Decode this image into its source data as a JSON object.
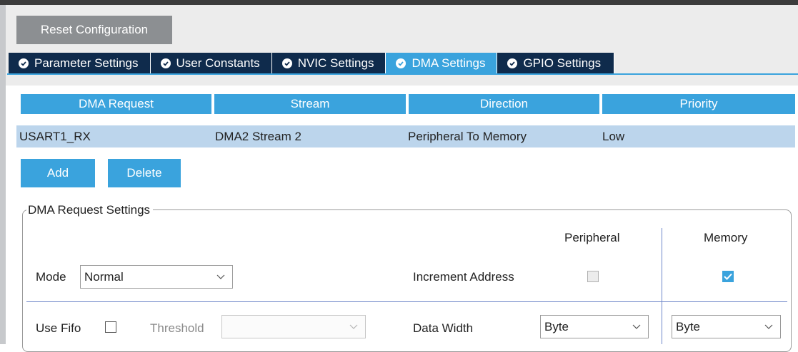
{
  "toolbar": {
    "reset_label": "Reset Configuration"
  },
  "tabs": [
    {
      "label": "Parameter Settings",
      "active": false
    },
    {
      "label": "User Constants",
      "active": false
    },
    {
      "label": "NVIC Settings",
      "active": false
    },
    {
      "label": "DMA Settings",
      "active": true
    },
    {
      "label": "GPIO Settings",
      "active": false
    }
  ],
  "dma_table": {
    "columns": [
      "DMA Request",
      "Stream",
      "Direction",
      "Priority"
    ],
    "rows": [
      {
        "request": "USART1_RX",
        "stream": "DMA2 Stream 2",
        "direction": "Peripheral To Memory",
        "priority": "Low"
      }
    ]
  },
  "actions": {
    "add_label": "Add",
    "delete_label": "Delete"
  },
  "settings": {
    "title": "DMA Request Settings",
    "peripheral_header": "Peripheral",
    "memory_header": "Memory",
    "mode_label": "Mode",
    "mode_value": "Normal",
    "increment_label": "Increment Address",
    "peripheral_increment": false,
    "memory_increment": true,
    "use_fifo_label": "Use Fifo",
    "use_fifo": false,
    "threshold_label": "Threshold",
    "threshold_value": "",
    "data_width_label": "Data Width",
    "peripheral_data_width": "Byte",
    "memory_data_width": "Byte"
  },
  "colors": {
    "accent": "#3aa3dd",
    "tab_dark": "#0f2b4c",
    "row_selected": "#bcd5ec",
    "button_gray": "#8c8f92"
  }
}
